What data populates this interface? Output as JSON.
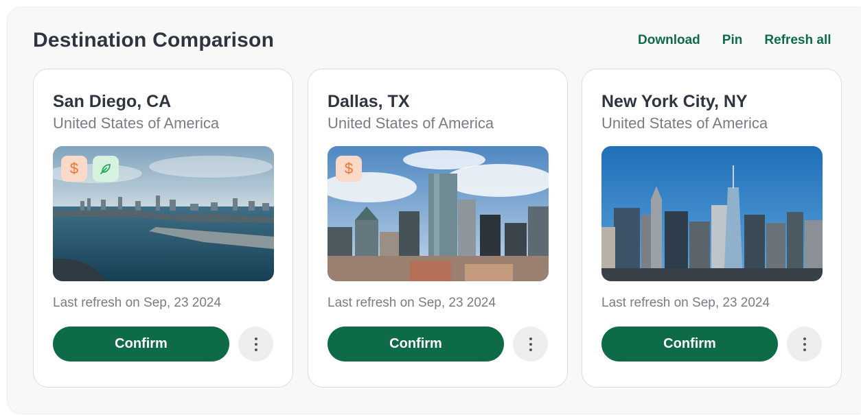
{
  "header": {
    "title": "Destination Comparison",
    "actions": [
      {
        "label": "Download"
      },
      {
        "label": "Pin"
      },
      {
        "label": "Refresh all"
      }
    ]
  },
  "colors": {
    "accent": "#0e6b48",
    "cost_badge_bg": "#fbd9c9",
    "cost_badge_fg": "#ef7434",
    "eco_badge_bg": "#d7f2df",
    "eco_badge_fg": "#24a55a"
  },
  "cards": [
    {
      "city": "San Diego, CA",
      "country": "United States of America",
      "badges": [
        "dollar-icon",
        "leaf-icon"
      ],
      "last_refresh": "Last refresh on Sep, 23 2024",
      "confirm_label": "Confirm"
    },
    {
      "city": "Dallas, TX",
      "country": "United States of America",
      "badges": [
        "dollar-icon"
      ],
      "last_refresh": "Last refresh on Sep, 23 2024",
      "confirm_label": "Confirm"
    },
    {
      "city": "New York City, NY",
      "country": "United States of America",
      "badges": [],
      "last_refresh": "Last refresh on Sep, 23 2024",
      "confirm_label": "Confirm"
    }
  ]
}
